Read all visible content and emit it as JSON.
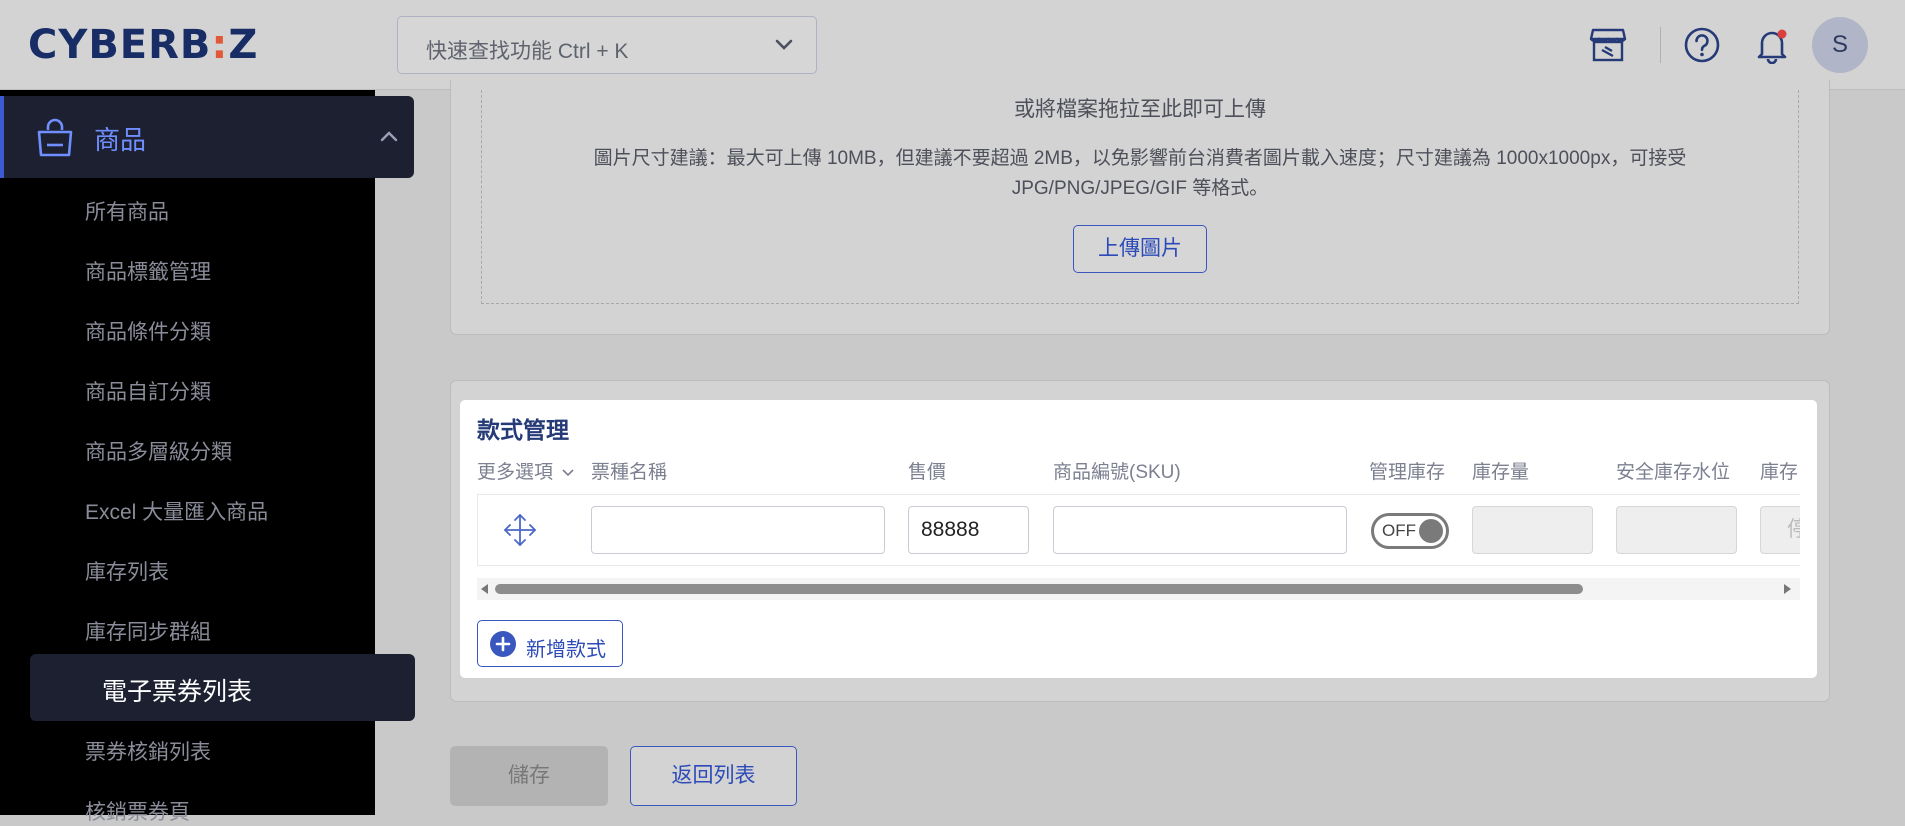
{
  "header": {
    "logo_text": "CYBERB:Z",
    "search_placeholder": "快速查找功能 Ctrl + K",
    "avatar_initial": "S"
  },
  "sidebar": {
    "group_label": "商品",
    "items": [
      "所有商品",
      "商品標籤管理",
      "商品條件分類",
      "商品自訂分類",
      "商品多層級分類",
      "Excel 大量匯入商品",
      "庫存列表",
      "庫存同步群組",
      "電子票券列表",
      "票券核銷列表",
      "核銷票券頁"
    ],
    "active_index": 8
  },
  "upload": {
    "drag_text": "或將檔案拖拉至此即可上傳",
    "size_line1": "圖片尺寸建議：最大可上傳 10MB，但建議不要超過 2MB，以免影響前台消費者圖片載入速度；尺寸建議為 1000x1000px，可接受",
    "size_line2": "JPG/PNG/JPEG/GIF 等格式。",
    "button_label": "上傳圖片"
  },
  "variants": {
    "title": "款式管理",
    "columns": [
      "更多選項",
      "票種名稱",
      "售價",
      "商品編號(SKU)",
      "管理庫存",
      "庫存量",
      "安全庫存水位",
      "庫存"
    ],
    "row": {
      "name": "",
      "price": "88888",
      "sku": "",
      "manage_stock": "OFF",
      "partial_placeholder": "停"
    },
    "add_label": "新增款式"
  },
  "actions": {
    "save_label": "儲存",
    "back_label": "返回列表"
  },
  "colors": {
    "brand": "#182c66",
    "accent": "#3a57bf",
    "sidebar_bg": "#000000"
  }
}
